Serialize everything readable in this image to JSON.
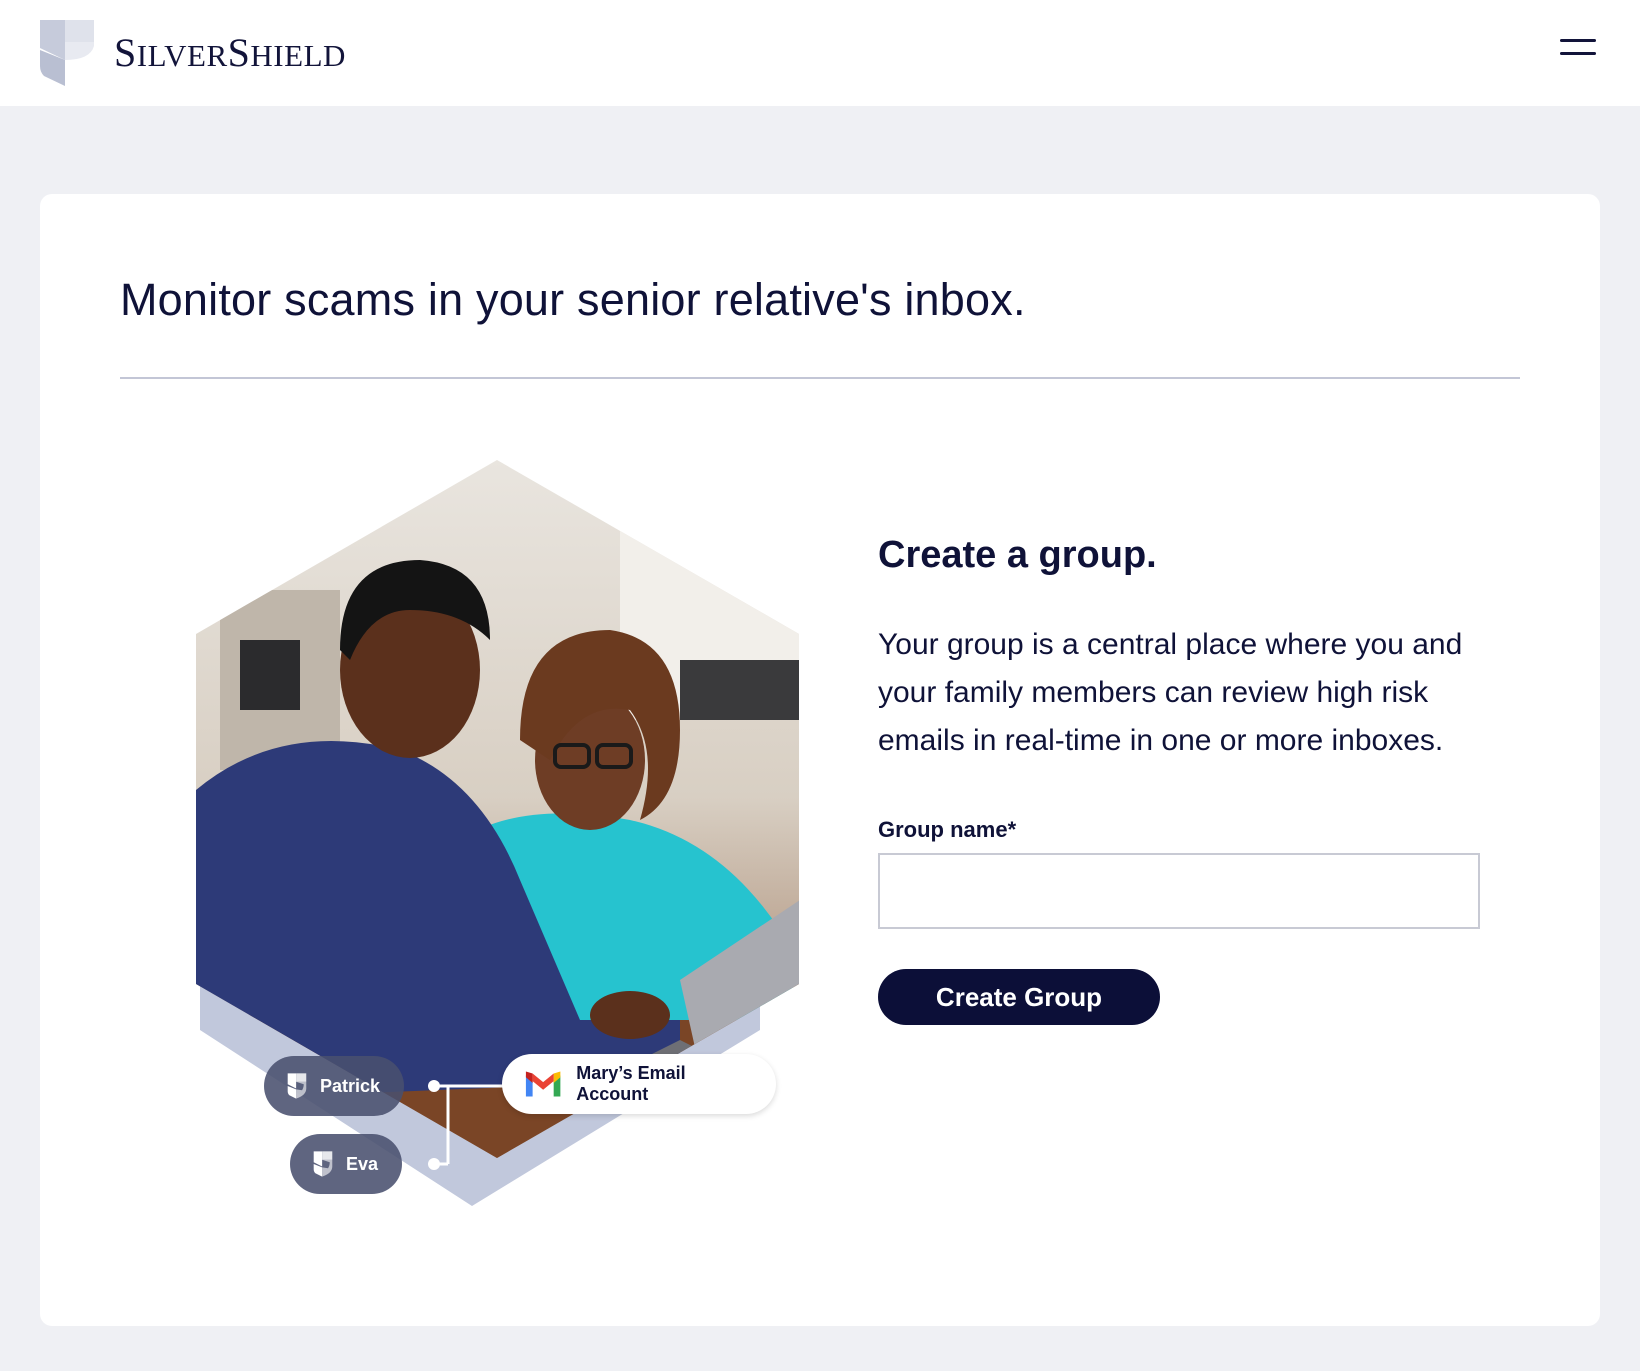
{
  "header": {
    "brand_name": "SilverShield",
    "brand_first_letter_1": "S",
    "brand_rest_1": "ILVER",
    "brand_first_letter_2": "S",
    "brand_rest_2": "HIELD",
    "menu_icon": "hamburger-menu-icon"
  },
  "main": {
    "title": "Monitor scams in your senior relative's inbox.",
    "illustration": {
      "chips": {
        "patrick": "Patrick",
        "eva": "Eva",
        "mary": "Mary’s Email Account"
      },
      "icons": [
        "shield-icon",
        "gmail-icon"
      ]
    },
    "form": {
      "heading": "Create a group.",
      "description": "Your group is a central place where you and your family members can review high risk emails in real-time in one or more inboxes.",
      "group_name_label": "Group name*",
      "group_name_value": "",
      "group_name_placeholder": "",
      "submit_label": "Create Group"
    }
  },
  "colors": {
    "brand_navy": "#0c0f38",
    "page_bg": "#eff0f4",
    "hex_accent": "#c1c8dc",
    "divider": "#c3c6d6"
  }
}
